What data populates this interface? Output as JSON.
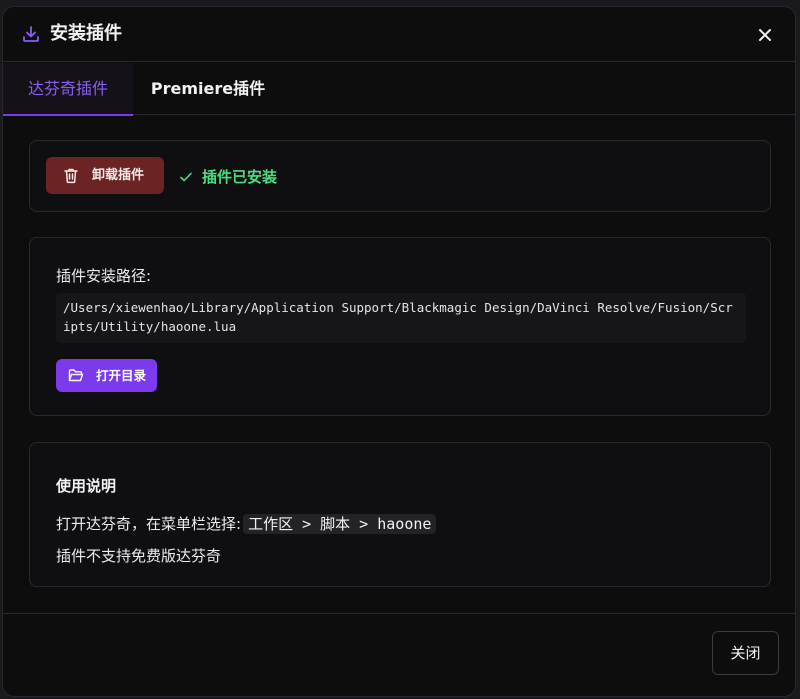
{
  "dialog": {
    "title": "安装插件",
    "icon": "download-icon"
  },
  "tabs": [
    {
      "label": "达芬奇插件",
      "active": true
    },
    {
      "label": "Premiere插件",
      "active": false
    }
  ],
  "install_status": {
    "uninstall_label": "卸载插件",
    "status_text": "插件已安装"
  },
  "path_section": {
    "label": "插件安装路径:",
    "path": "/Users/xiewenhao/Library/Application Support/Blackmagic Design/DaVinci Resolve/Fusion/Scripts/Utility/haoone.lua",
    "open_button_label": "打开目录"
  },
  "usage": {
    "title": "使用说明",
    "line1_prefix": "打开达芬奇，在菜单栏选择:",
    "line1_code": "工作区 > 脚本 > haoone",
    "line2": "插件不支持免费版达芬奇"
  },
  "footer": {
    "close_label": "关闭"
  },
  "colors": {
    "accent": "#7c3aed",
    "danger": "#6b2323",
    "success": "#4ade80"
  }
}
